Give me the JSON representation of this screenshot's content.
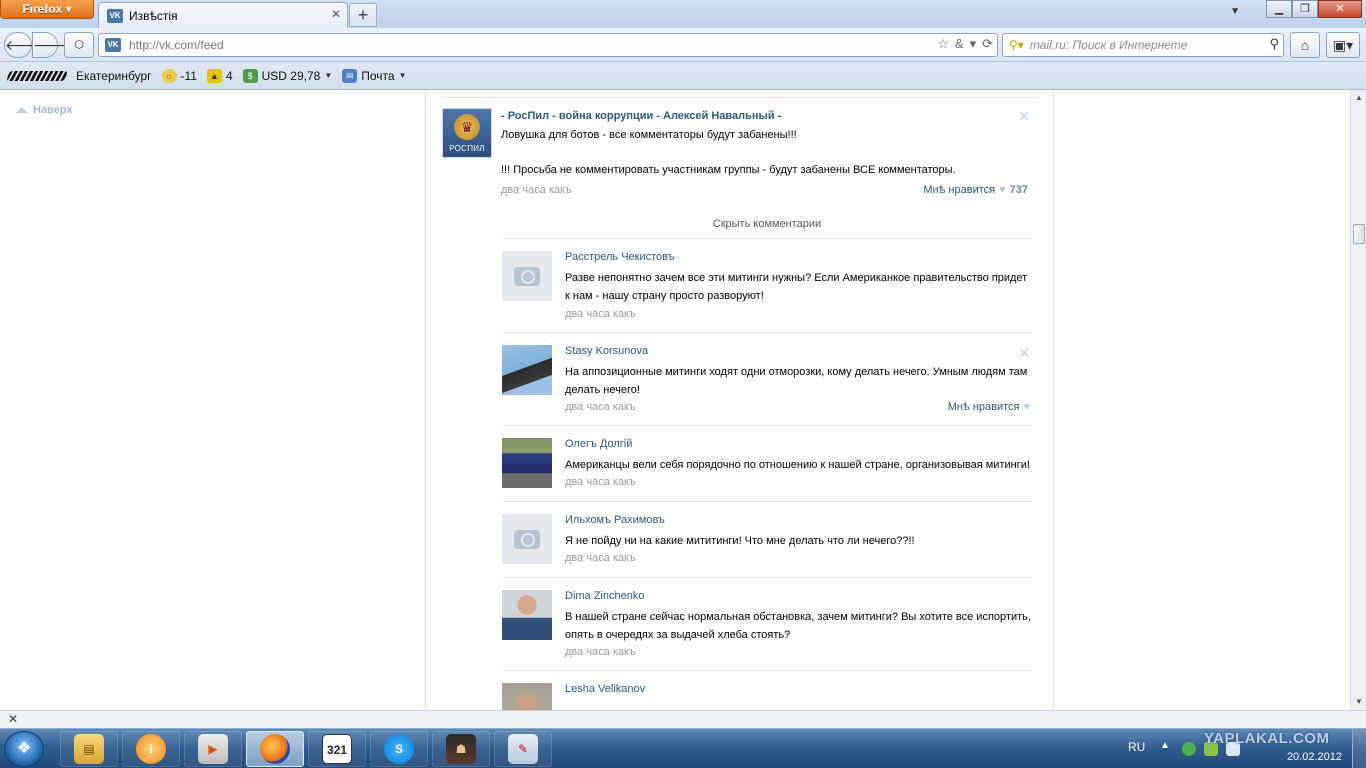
{
  "browser": {
    "menu_button": "Firefox",
    "tab_title": "Извѣстія",
    "url": "http://vk.com/feed",
    "search_placeholder": "mail.ru: Поиск в Интернете",
    "favicon_label": "VK"
  },
  "toolbar": {
    "city": "Екатеринбург",
    "weather": "-11",
    "traffic": "4",
    "usd": "USD 29,78",
    "mail": "Почта"
  },
  "page": {
    "to_top": "Наверх",
    "post": {
      "group_name": "- РосПил - война коррупции - Алексей Навальный -",
      "avatar_text": "РОСПИЛ",
      "line1": "Ловушка для ботов - все комментаторы будут забанены!!!",
      "line2": "!!! Просьба не комментировать участникам группы - будут забанены ВСЕ комментаторы.",
      "time": "два часа какъ",
      "like_label": "Мнѣ нравится",
      "like_count": "737"
    },
    "hide_comments": "Скрыть комментарии",
    "comments": [
      {
        "name": "Расстрель Чекистовъ",
        "text": "Разве непонятно зачем все эти митинги нужны? Если Американкое правительство придет к нам - нашу страну просто разворуют!",
        "time": "два часа какъ"
      },
      {
        "name": "Stasy Korsunova",
        "text": "На аппозиционные митинги ходят одни отморозки, кому делать нечего. Умным людям там делать нечего!",
        "time": "два часа какъ",
        "like_label": "Мнѣ нравится"
      },
      {
        "name": "Олегъ Долгій",
        "text": "Американцы вели себя порядочно по отношению к нашей стране, организовывая митинги!",
        "time": "два часа какъ"
      },
      {
        "name": "Ильхомъ Рахимовъ",
        "text": "Я не пойду ни на какие мититинги! Что мне делать что ли нечего??!!",
        "time": "два часа какъ"
      },
      {
        "name": "Dima Zinchenko",
        "text": "В нашей стране сейчас нормальная обстановка, зачем митинги? Вы хотите все испортить, опять в очередях за выдачей хлеба стоять?",
        "time": "два часа какъ"
      },
      {
        "name": "Lesha Velikanov",
        "text": "",
        "time": ""
      }
    ]
  },
  "taskbar": {
    "lang": "RU",
    "date": "20.02.2012",
    "calendar_icon": "321",
    "watermark": "YAPLAKAL.COM"
  },
  "icons": {
    "back": "arrow-left-icon",
    "forward": "arrow-right-icon",
    "home": "home-icon",
    "reload": "reload-icon",
    "bookmark": "star-icon",
    "close": "close-icon",
    "heart": "heart-icon",
    "camera": "camera-icon"
  },
  "colors": {
    "vk_link": "#2b587a",
    "muted": "#999999",
    "firefox_orange": "#e0701e"
  }
}
